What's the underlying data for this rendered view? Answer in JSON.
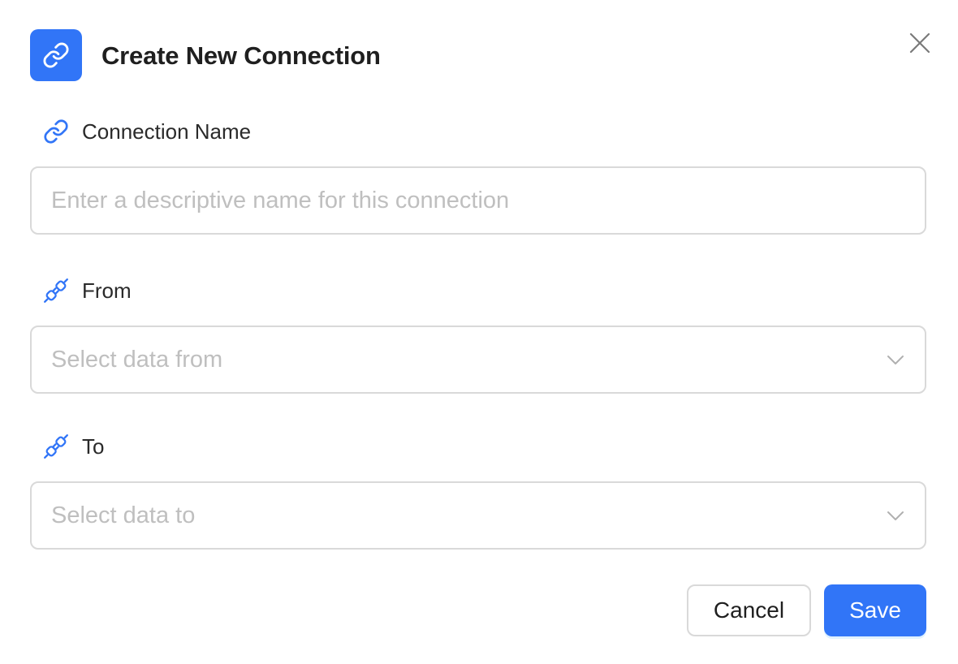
{
  "colors": {
    "accent": "#3175f7",
    "border": "#d9d9d9",
    "placeholder": "#bfbfbf"
  },
  "dialog": {
    "title": "Create New Connection",
    "header_icon": "link-icon",
    "close_icon": "close-icon"
  },
  "fields": {
    "name": {
      "label": "Connection Name",
      "icon": "link-icon",
      "value": "",
      "placeholder": "Enter a descriptive name for this connection"
    },
    "from": {
      "label": "From",
      "icon": "plug-connect-icon",
      "selected": "",
      "placeholder": "Select data from"
    },
    "to": {
      "label": "To",
      "icon": "plug-connect-icon",
      "selected": "",
      "placeholder": "Select data to"
    }
  },
  "actions": {
    "cancel_label": "Cancel",
    "save_label": "Save"
  }
}
